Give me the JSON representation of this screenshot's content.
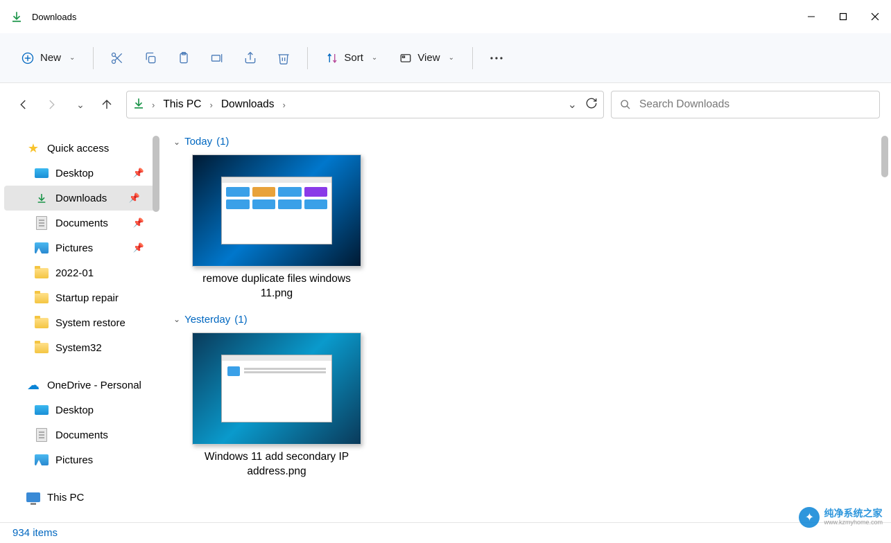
{
  "window": {
    "title": "Downloads"
  },
  "toolbar": {
    "new_label": "New",
    "sort_label": "Sort",
    "view_label": "View"
  },
  "breadcrumb": {
    "items": [
      "This PC",
      "Downloads"
    ]
  },
  "search": {
    "placeholder": "Search Downloads"
  },
  "sidebar": {
    "quick_access": "Quick access",
    "desktop": "Desktop",
    "downloads": "Downloads",
    "documents": "Documents",
    "pictures": "Pictures",
    "f_2022_01": "2022-01",
    "f_startup": "Startup repair",
    "f_restore": "System restore",
    "f_sys32": "System32",
    "onedrive": "OneDrive - Personal",
    "od_desktop": "Desktop",
    "od_documents": "Documents",
    "od_pictures": "Pictures",
    "this_pc": "This PC"
  },
  "groups": {
    "today_label": "Today",
    "today_count": "(1)",
    "yesterday_label": "Yesterday",
    "yesterday_count": "(1)"
  },
  "files": {
    "file1": "remove duplicate files windows 11.png",
    "file2": "Windows 11 add secondary IP address.png"
  },
  "status": {
    "item_count": "934 items"
  },
  "watermark": {
    "main": "纯净系统之家",
    "sub": "www.kzmyhome.com"
  }
}
